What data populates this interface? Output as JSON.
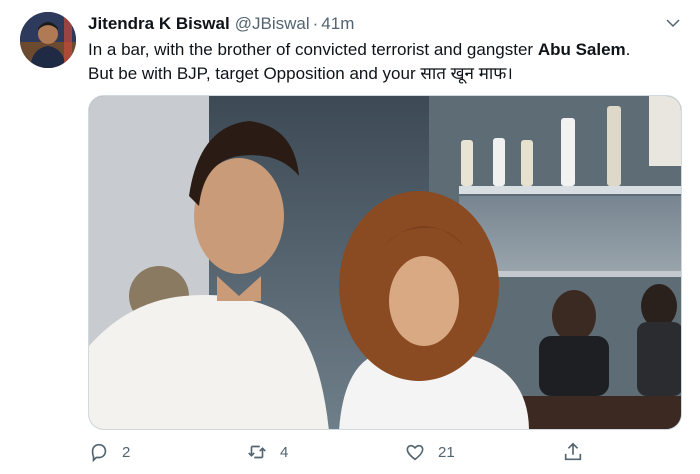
{
  "tweet": {
    "author": {
      "display_name": "Jitendra K Biswal",
      "handle": "@JBiswal",
      "separator": "·",
      "time": "41m",
      "avatar_icon": "user-avatar"
    },
    "text": {
      "line1_start": "In a bar, with the brother of convicted terrorist and gangster ",
      "line1_bold": "Abu Salem",
      "line1_end": ".",
      "line2": "But be with BJP, target Opposition and your सात खून माफ।"
    },
    "media": {
      "type": "photo"
    },
    "actions": {
      "reply_count": "2",
      "retweet_count": "4",
      "like_count": "21"
    }
  },
  "colors": {
    "text_primary": "#0f1419",
    "text_secondary": "#536471",
    "border": "#cfd9de"
  }
}
